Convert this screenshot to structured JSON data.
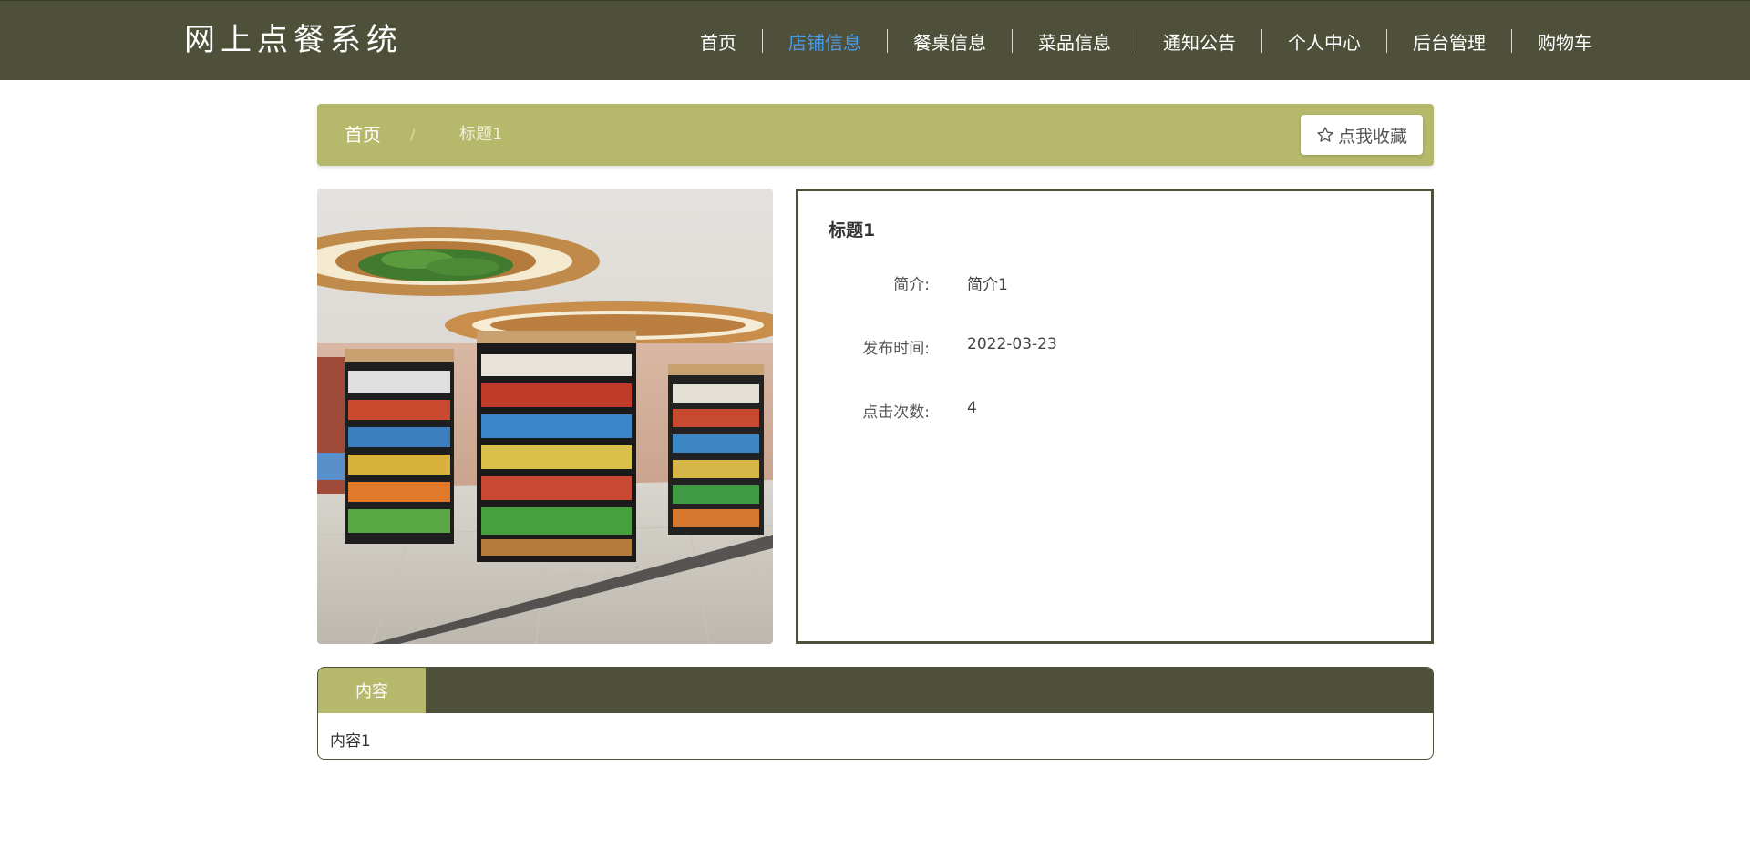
{
  "header": {
    "logo": "网上点餐系统",
    "nav": [
      {
        "label": "首页",
        "active": false
      },
      {
        "label": "店铺信息",
        "active": true
      },
      {
        "label": "餐桌信息",
        "active": false
      },
      {
        "label": "菜品信息",
        "active": false
      },
      {
        "label": "通知公告",
        "active": false
      },
      {
        "label": "个人中心",
        "active": false
      },
      {
        "label": "后台管理",
        "active": false
      },
      {
        "label": "购物车",
        "active": false
      }
    ]
  },
  "breadcrumb": {
    "home": "首页",
    "separator": "/",
    "current": "标题1",
    "favorite_label": "点我收藏",
    "favorite_icon": "star-outline-icon"
  },
  "detail": {
    "title": "标题1",
    "rows": [
      {
        "key": "简介:",
        "value": "简介1"
      },
      {
        "key": "发布时间:",
        "value": "2022-03-23"
      },
      {
        "key": "点击次数:",
        "value": "4"
      }
    ]
  },
  "content": {
    "tab_label": "内容",
    "text": "内容1"
  },
  "colors": {
    "header_bg": "#4e5039",
    "accent": "#b6b96b",
    "active_nav": "#4a9be8"
  }
}
